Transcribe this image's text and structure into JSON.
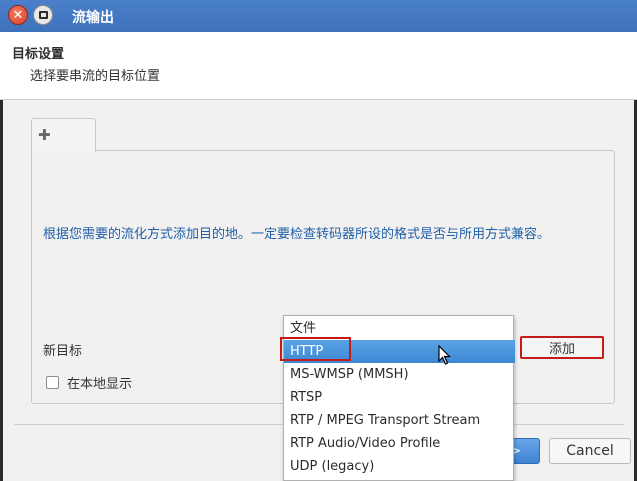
{
  "window": {
    "title": "流输出"
  },
  "header": {
    "title": "目标设置",
    "subtitle": "选择要串流的目标位置"
  },
  "tab": {
    "icon": "plus-icon"
  },
  "body": {
    "description": "根据您需要的流化方式添加目的地。一定要检查转码器所设的格式是否与所用方式兼容。",
    "new_target_label": "新目标",
    "add_button": "添加",
    "local_display_label": "在本地显示",
    "local_display_checked": false
  },
  "footer": {
    "next_button": ">",
    "cancel_button": "Cancel"
  },
  "dropdown": {
    "selected": "HTTP",
    "options": [
      "文件",
      "HTTP",
      "MS-WMSP (MMSH)",
      "RTSP",
      "RTP / MPEG Transport Stream",
      "RTP Audio/Video Profile",
      "UDP (legacy)"
    ]
  },
  "colors": {
    "titlebar": "#4a7fc9",
    "selection": "#3d88d4",
    "highlight_border": "#c41b1b",
    "description_text": "#1f5fa8"
  }
}
